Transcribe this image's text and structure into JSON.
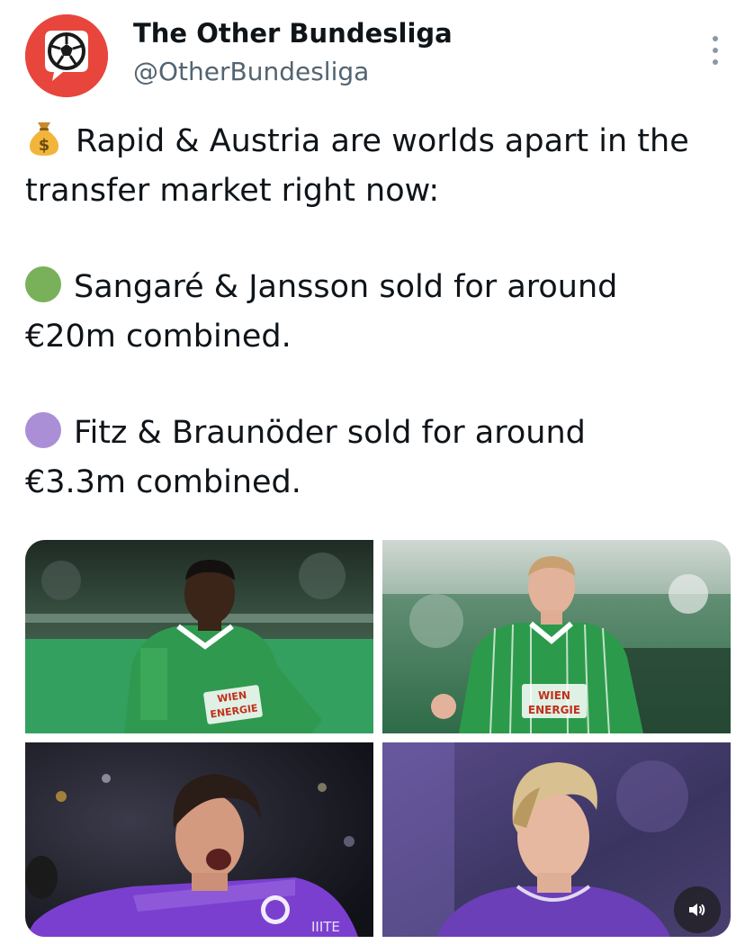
{
  "author": {
    "display_name": "The Other Bundesliga",
    "handle": "@OtherBundesliga",
    "avatar_icon": "soccer-ball-speech-bubble-icon",
    "avatar_color": "#e8453c"
  },
  "more_icon": "more-vertical-icon",
  "tweet": {
    "paragraphs": [
      {
        "emoji": "money-bag-emoji",
        "lines": [
          "Rapid & Austria are worlds apart in the",
          "transfer market right now:"
        ]
      },
      {
        "emoji": "green-circle-emoji",
        "lines": [
          "Sangaré & Jansson sold for around",
          "€20m combined."
        ]
      },
      {
        "emoji": "purple-circle-emoji",
        "lines": [
          "Fitz & Braunöder sold for around",
          "€3.3m combined."
        ]
      }
    ]
  },
  "media": {
    "photos": [
      {
        "subject": "Rapid player in green kit",
        "sponsor": [
          "WIEN",
          "ENERGIE"
        ]
      },
      {
        "subject": "Rapid player in green striped kit",
        "sponsor": [
          "WIEN",
          "ENERGIE"
        ]
      },
      {
        "subject": "Austria player in purple kit shouting",
        "kit_text": "IIITE"
      },
      {
        "subject": "Austria player in purple kit"
      }
    ],
    "audio_icon": "speaker-volume-icon"
  },
  "colors": {
    "rapid_green": "#2e8b4a",
    "austria_purple": "#7b4fc9",
    "text": "#0f1419",
    "secondary_text": "#536471"
  }
}
